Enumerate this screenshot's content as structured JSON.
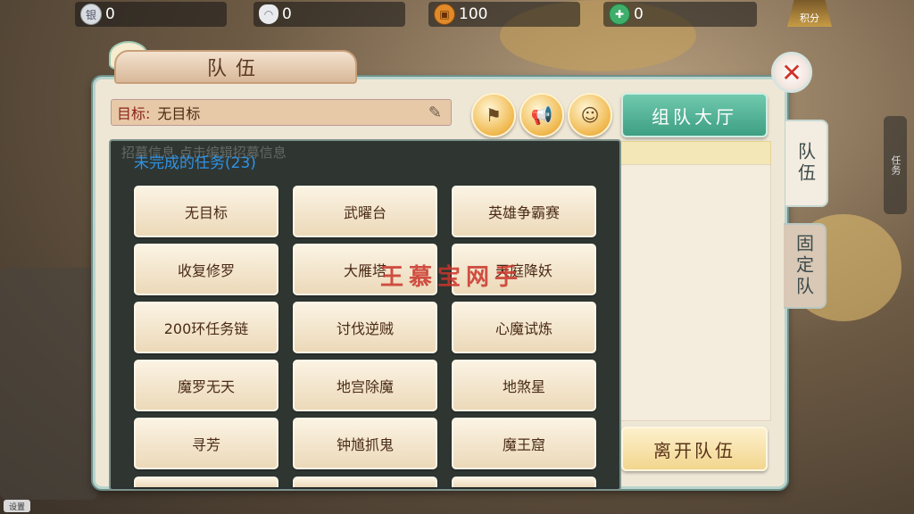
{
  "resources": [
    {
      "icon": "silver-note-icon",
      "glyph": "银",
      "value": "0"
    },
    {
      "icon": "silver-ingot-icon",
      "glyph": "◠",
      "value": "0"
    },
    {
      "icon": "copper-coin-icon",
      "glyph": "▣",
      "value": "100"
    },
    {
      "icon": "jade-icon",
      "glyph": "✚",
      "value": "0"
    }
  ],
  "points_label": "积分",
  "panel": {
    "title": "队伍",
    "target_label": "目标:",
    "target_value": "无目标",
    "lobby_button": "组队大厅",
    "leave_button": "离开队伍",
    "ghost_text": "招募信息    点击编辑招募信息"
  },
  "side_tabs": {
    "team": "队伍",
    "fixed": "固定队",
    "mini": "任务"
  },
  "task_list": {
    "header": "未完成的任务(23)",
    "tasks": [
      "无目标",
      "武曜台",
      "英雄争霸赛",
      "收复修罗",
      "大雁塔",
      "天庭降妖",
      "200环任务链",
      "讨伐逆贼",
      "心魔试炼",
      "魔罗无天",
      "地宫除魔",
      "地煞星",
      "寻芳",
      "钟馗抓鬼",
      "魔王窟"
    ]
  },
  "watermark": "王慕宝网手",
  "bottom_chip": "设置",
  "colors": {
    "accent_teal": "#3d9f83",
    "header_blue": "#2f93e6",
    "close_red": "#d0322a"
  }
}
